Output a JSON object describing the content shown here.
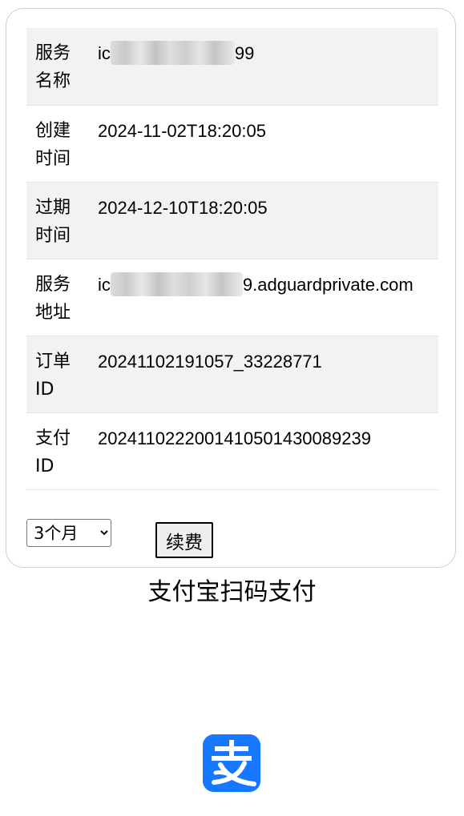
{
  "service": {
    "rows": [
      {
        "label": "服务名称",
        "value_prefix": "ic",
        "value_suffix": "99"
      },
      {
        "label": "创建时间",
        "value": "2024-11-02T18:20:05"
      },
      {
        "label": "过期时间",
        "value": "2024-12-10T18:20:05"
      },
      {
        "label": "服务地址",
        "value_prefix": "ic",
        "value_suffix": "9.adguardprivate.com"
      },
      {
        "label": "订单ID",
        "value": "20241102191057_33228771"
      },
      {
        "label": "支付ID",
        "value": "2024110222001410501430089239"
      }
    ]
  },
  "renewal": {
    "period_selected": "3个月",
    "button_label": "续费"
  },
  "payment": {
    "heading": "支付宝扫码支付",
    "logo_icon": "alipay-icon",
    "brand_color": "#1677ff"
  }
}
